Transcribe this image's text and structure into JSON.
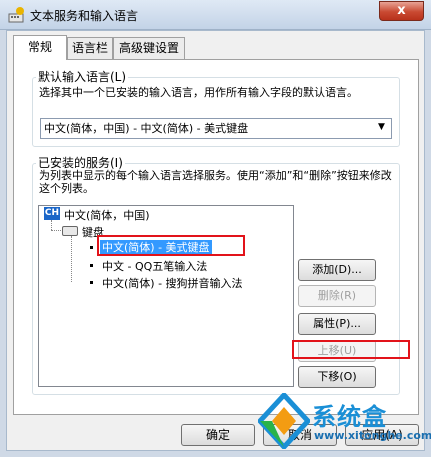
{
  "window": {
    "title": "文本服务和输入语言",
    "close_glyph": "x"
  },
  "tabs": [
    {
      "label": "常规"
    },
    {
      "label": "语言栏"
    },
    {
      "label": "高级键设置"
    }
  ],
  "default_language": {
    "legend": "默认输入语言(L)",
    "description": "选择其中一个已安装的输入语言，用作所有输入字段的默认语言。",
    "selected_value": "中文(简体，中国) - 中文(简体) - 美式键盘",
    "arrow": "▼"
  },
  "installed_services": {
    "legend": "已安装的服务(I)",
    "description": "为列表中显示的每个输入语言选择服务。使用“添加”和“删除”按钮来修改这个列表。",
    "language_badge": "CH",
    "language": "中文(简体，中国)",
    "category": "键盘",
    "items": [
      {
        "label": "中文(简体) - 美式键盘",
        "selected": true
      },
      {
        "label": "中文 - QQ五笔输入法",
        "selected": false
      },
      {
        "label": "中文(简体) - 搜狗拼音输入法",
        "selected": false
      }
    ]
  },
  "side_buttons": {
    "add": "添加(D)...",
    "remove": "删除(R)",
    "properties": "属性(P)...",
    "move_up": "上移(U)",
    "move_down": "下移(O)"
  },
  "bottom_buttons": {
    "ok": "确定",
    "cancel": "取消",
    "apply": "应用(A)"
  },
  "watermark": {
    "brand": "系统盒",
    "url": "www.xitonghe.com"
  }
}
